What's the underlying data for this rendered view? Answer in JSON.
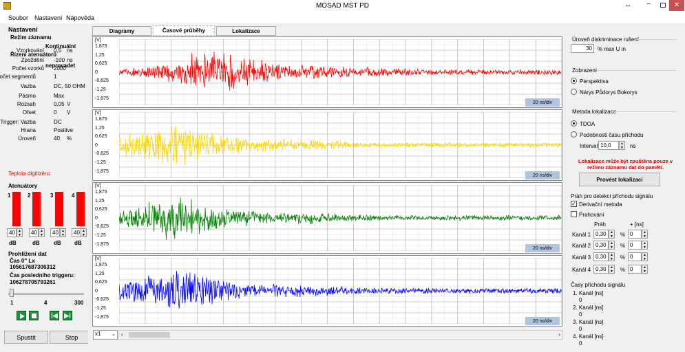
{
  "window": {
    "title": "MOSAD MST PD",
    "resize_icon": "↔"
  },
  "menu": [
    "Soubor",
    "Nastavení",
    "Nápověda"
  ],
  "left": {
    "nastaveni": "Nastavení",
    "rezim": "Režim záznamu",
    "kontinualni": "Kontinuální",
    "rizeni": "Řízení atenuátorů",
    "neprovadet": "neprovadet",
    "params": [
      {
        "label": "Vzorkování",
        "value": "0,5",
        "unit": "ns"
      },
      {
        "label": "Zpoždění",
        "value": "-100",
        "unit": "ns"
      },
      {
        "label": "Počet vzorků",
        "value": "2000",
        "unit": ""
      },
      {
        "label": "Počet segmentů",
        "value": "1",
        "unit": ""
      },
      {
        "label": "Vazba",
        "value": "DC, 50 OHM",
        "unit": ""
      },
      {
        "label": "Pásmo",
        "value": "Max",
        "unit": ""
      },
      {
        "label": "Rozsah",
        "value": "0,05",
        "unit": "V"
      },
      {
        "label": "Ofset",
        "value": "0",
        "unit": "V"
      },
      {
        "label": "Trigger: Vazba",
        "value": "DC",
        "unit": ""
      },
      {
        "label": "Hrana",
        "value": "Positive",
        "unit": ""
      },
      {
        "label": "Úroveň",
        "value": "40",
        "unit": "%"
      }
    ],
    "teplota": "Teplota digitizéru:",
    "atenuatory": "Atenuátory",
    "att_nums": [
      "1",
      "2",
      "3",
      "4"
    ],
    "att_vals": [
      "40",
      "40",
      "40",
      "40"
    ],
    "db": "dB",
    "prohlizeni": "Prohlížení dat",
    "cas0": "Čas 0\" Lx",
    "cas0_val": "105617687306312",
    "caslast": "Čas posledního triggeru:",
    "caslast_val": "106278705793261",
    "slider_min": "1",
    "slider_mid": "4",
    "slider_max": "300",
    "spustit": "Spustit",
    "stop": "Stop"
  },
  "tabs": [
    "Diagramy",
    "Časové průběhy",
    "Lokalizace"
  ],
  "charts": {
    "unit": "[V]",
    "yticks": [
      "1,875",
      "1,25",
      "0,625",
      "0",
      "-0,625",
      "-1,25",
      "-1,875"
    ],
    "div_label": "20 ns/div",
    "colors": [
      "#ff0000",
      "#ffd700",
      "#008000",
      "#0000ff"
    ],
    "zoom": "x1",
    "burst_centers": [
      0.22,
      0.11,
      0.12,
      0.12
    ]
  },
  "right": {
    "uroven_title": "Úroveň diskriminace rušení",
    "uroven_val": "30",
    "uroven_unit": "% max U in",
    "zobrazeni": "Zobrazení",
    "perspektiva": "Perspektiva",
    "narys": "Nárys Půdorys Bokorys",
    "metoda": "Metoda lokalizace",
    "tdoa": "TDOA",
    "podobnost": "Podobnosti času příchodu",
    "interval": "Interval",
    "interval_val": "10,0",
    "interval_unit": "ns",
    "warn": "Lokalizace může být zpuštěna pouze v režimu záznamu dat do paměti.",
    "provest": "Provést lokalizaci",
    "prah_title": "Práh pro detekci příchodu signálu",
    "derivacni": "Derivační metoda",
    "prahovani": "Prahování",
    "prah_col": "Práh",
    "plus_col": "+ [ns]",
    "kanaly": [
      {
        "name": "Kanál 1",
        "prah": "0,30",
        "plus": "0"
      },
      {
        "name": "Kanál 2",
        "prah": "0,30",
        "plus": "0"
      },
      {
        "name": "Kanál 3",
        "prah": "0,30",
        "plus": "0"
      },
      {
        "name": "Kanál 4",
        "prah": "0,30",
        "plus": "0"
      }
    ],
    "pct": "%",
    "casy_title": "Časy příchodu signálu",
    "casy": [
      {
        "label": "1. Kanál [ns]",
        "val": "0"
      },
      {
        "label": "2. Kanál [ns]",
        "val": "0"
      },
      {
        "label": "3. Kanál [ns]",
        "val": "0"
      },
      {
        "label": "4. Kanál [ns]",
        "val": "0"
      }
    ]
  }
}
